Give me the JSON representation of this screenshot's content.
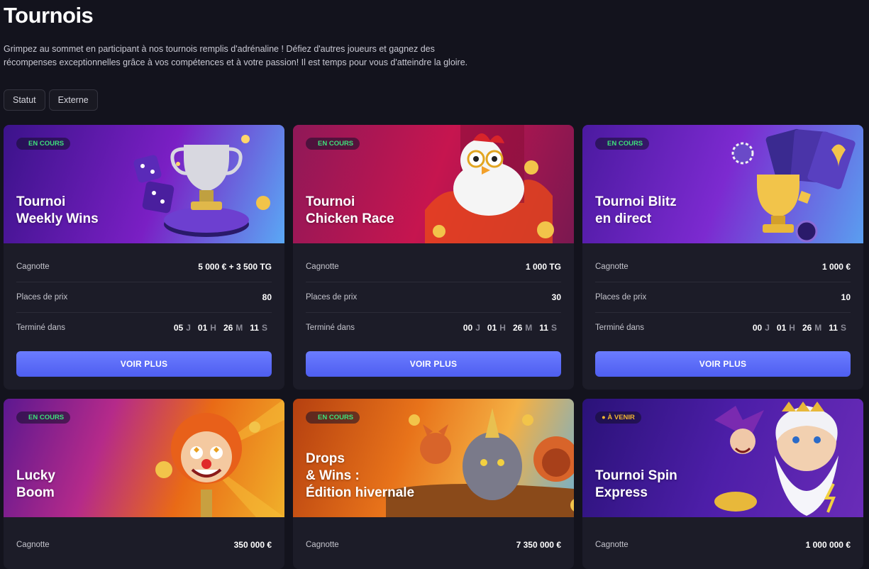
{
  "page": {
    "title": "Tournois",
    "intro_line1": "Grimpez au sommet en participant à nos tournois remplis d'adrénaline ! Défiez d'autres joueurs et gagnez des",
    "intro_line2": "récompenses exceptionnelles grâce à vos compétences et à votre passion! Il est temps pour vous d'atteindre la gloire."
  },
  "filters": {
    "status": "Statut",
    "external": "Externe"
  },
  "labels": {
    "pool": "Cagnotte",
    "places": "Places de prix",
    "ends": "Terminé dans",
    "cta": "VOIR PLUS",
    "unit_d": "J",
    "unit_h": "H",
    "unit_m": "M",
    "unit_s": "S"
  },
  "cards": [
    {
      "badge": "EN COURS",
      "status": "live",
      "title": "Tournoi\nWeekly Wins",
      "pool": "5 000 € + 3 500 TG",
      "places": "80",
      "days": "05",
      "hours": "01",
      "minutes": "26",
      "seconds": "11"
    },
    {
      "badge": "EN COURS",
      "status": "live",
      "title": "Tournoi\nChicken Race",
      "pool": "1 000 TG",
      "places": "30",
      "days": "00",
      "hours": "01",
      "minutes": "26",
      "seconds": "11"
    },
    {
      "badge": "EN COURS",
      "status": "live",
      "title": "Tournoi Blitz\nen direct",
      "pool": "1 000 €",
      "places": "10",
      "days": "00",
      "hours": "01",
      "minutes": "26",
      "seconds": "11"
    },
    {
      "badge": "EN COURS",
      "status": "live",
      "title": "Lucky\nBoom",
      "pool": "350 000 €"
    },
    {
      "badge": "EN COURS",
      "status": "live",
      "title": "Drops\n& Wins :\nÉdition hivernale",
      "pool": "7 350 000 €"
    },
    {
      "badge": "● À VENIR",
      "status": "upcoming",
      "title": "Tournoi Spin\nExpress",
      "pool": "1 000 000 €"
    }
  ]
}
